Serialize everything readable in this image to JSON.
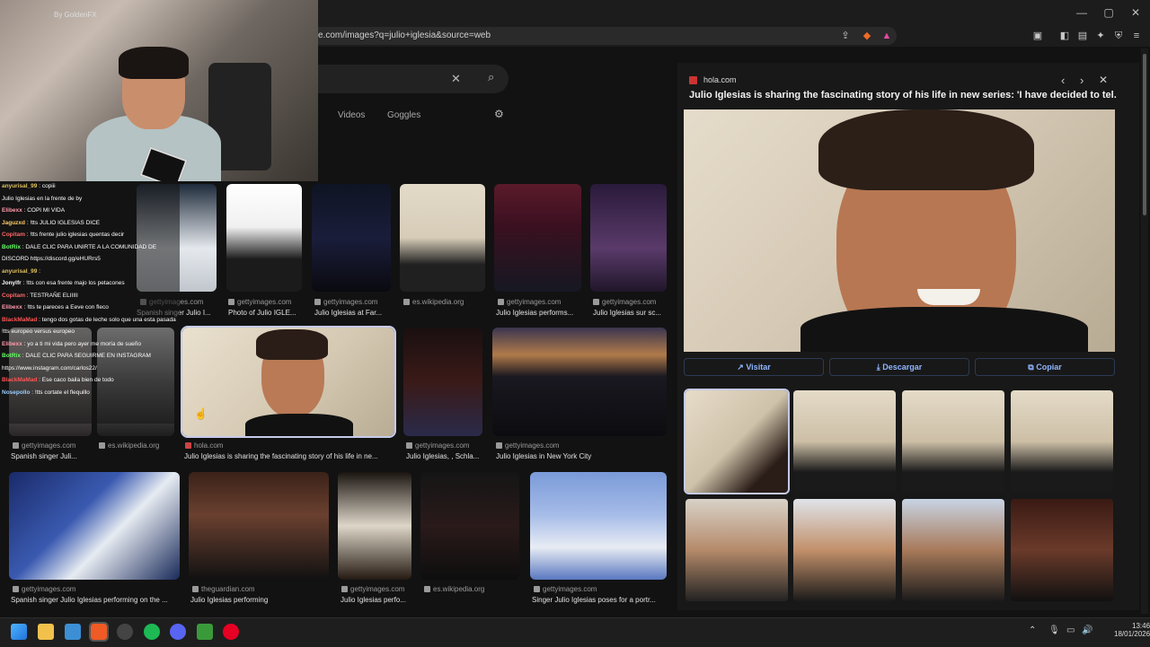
{
  "browser": {
    "url": "e.com/images?q=julio+iglesia&source=web",
    "window_controls": [
      "—",
      "▢",
      "✕"
    ]
  },
  "search": {
    "clear_icon": "close-icon",
    "search_icon": "search-icon",
    "tabs": [
      "Videos",
      "Goggles"
    ]
  },
  "webcam": {
    "label": "By GoldenFX"
  },
  "chat": [
    {
      "user": "anyurisal_99",
      "text": "copiii",
      "color": "#e0c060"
    },
    {
      "user": "",
      "text": "Julio Iglesias en la frente de by",
      "color": "#e88"
    },
    {
      "user": "Elibexx",
      "text": "COPI MI VIDA",
      "color": "#f9a"
    },
    {
      "user": "Jaguzxd",
      "text": "!tts JULIO IGLESIAS DICE",
      "color": "#fc6"
    },
    {
      "user": "Copitam",
      "text": "!tts frente julio iglesias quentas decir",
      "color": "#f66"
    },
    {
      "user": "BotRix",
      "text": "DALE CLIC PARA UNIRTE A LA COMUNIDAD DE",
      "color": "#6f6"
    },
    {
      "user": "",
      "text": "DISCORD https://discord.gg/eHURrs5",
      "color": "#fff"
    },
    {
      "user": "anyurisal_99",
      "text": "",
      "color": "#e0c060"
    },
    {
      "user": "Jonylfr",
      "text": "!tts con esa frente majo los petacones",
      "color": "#fff"
    },
    {
      "user": "Copitam",
      "text": "TESTRAÑE ELIIIII",
      "color": "#f66"
    },
    {
      "user": "Elibexx",
      "text": "!tts te pareces a Eeve con fleco",
      "color": "#f9a"
    },
    {
      "user": "BlackMaMad",
      "text": "tengo dos gotas de leche solo que una esta pasada",
      "color": "#f55"
    },
    {
      "user": "",
      "text": "!tts europeo versus europeo",
      "color": "#fff"
    },
    {
      "user": "Elibexx",
      "text": "yo a ti mi vida pero ayer me moría de sueño",
      "color": "#f9a"
    },
    {
      "user": "BotRix",
      "text": "DALE CLIC PARA SEGUIRME EN INSTAGRAM",
      "color": "#6f6"
    },
    {
      "user": "",
      "text": "https://www.instagram.com/carlos22/",
      "color": "#fff"
    },
    {
      "user": "BlackMaMad",
      "text": "Ese caco baila bien de todo",
      "color": "#f55"
    },
    {
      "user": "Nosepollo",
      "text": "!tts cortate el flequillo",
      "color": "#9cf"
    }
  ],
  "grid": {
    "row1": [
      {
        "source": "gettyimages.com",
        "caption": "Spanish singer Julio I..."
      },
      {
        "source": "gettyimages.com",
        "caption": "Photo of Julio IGLE..."
      },
      {
        "source": "gettyimages.com",
        "caption": "Julio Iglesias at Far..."
      },
      {
        "source": "es.wikipedia.org",
        "caption": ""
      },
      {
        "source": "gettyimages.com",
        "caption": "Julio Iglesias performs..."
      },
      {
        "source": "gettyimages.com",
        "caption": "Julio Iglesias sur sc..."
      }
    ],
    "row2": [
      {
        "source": "gettyimages.com",
        "caption": "Spanish singer Juli..."
      },
      {
        "source": "es.wikipedia.org",
        "caption": ""
      },
      {
        "source": "hola.com",
        "caption": "Julio Iglesias is sharing the fascinating story of his life in ne..."
      },
      {
        "source": "gettyimages.com",
        "caption": "Julio Iglesias, , Schla..."
      },
      {
        "source": "gettyimages.com",
        "caption": "Julio Iglesias in New York City"
      }
    ],
    "row3": [
      {
        "source": "gettyimages.com",
        "caption": "Spanish singer Julio Iglesias performing on the ..."
      },
      {
        "source": "theguardian.com",
        "caption": "Julio Iglesias performing"
      },
      {
        "source": "gettyimages.com",
        "caption": "Julio Iglesias perfo..."
      },
      {
        "source": "es.wikipedia.org",
        "caption": ""
      },
      {
        "source": "gettyimages.com",
        "caption": "Singer Julio Iglesias poses for a portr..."
      }
    ]
  },
  "panel": {
    "source": "hola.com",
    "title": "Julio Iglesias is sharing the fascinating story of his life in new series: 'I have decided to tel...",
    "nav": [
      "‹",
      "›",
      "✕"
    ],
    "buttons": {
      "visit": "Visitar",
      "download": "Descargar",
      "copy": "Copiar"
    }
  },
  "taskbar": {
    "time": "13:46",
    "date": "18/01/2026"
  }
}
